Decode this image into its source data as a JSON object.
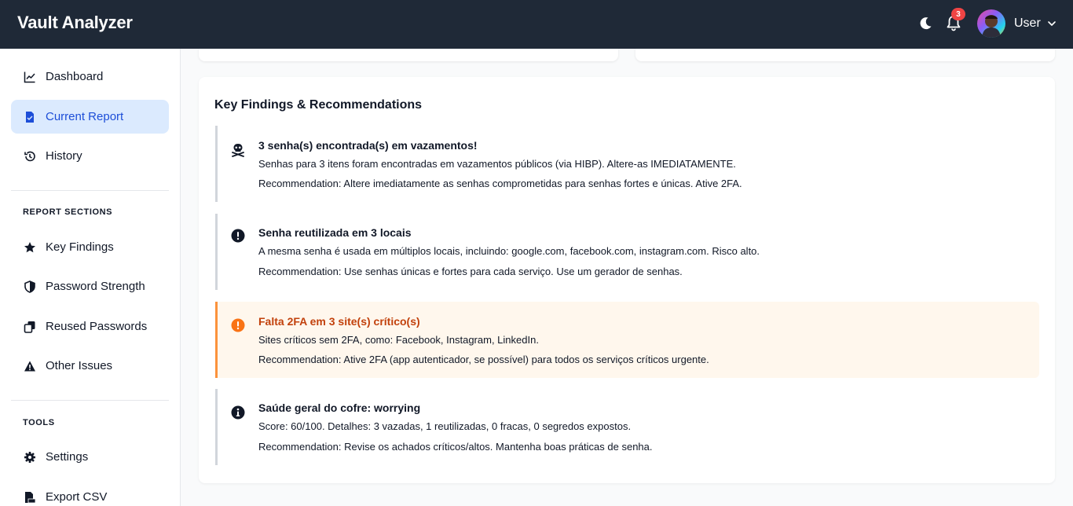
{
  "header": {
    "app_title": "Vault Analyzer",
    "notification_count": "3",
    "user_name": "User"
  },
  "sidebar": {
    "items": [
      {
        "label": "Dashboard",
        "icon": "chart-line-icon"
      },
      {
        "label": "Current Report",
        "icon": "file-report-icon",
        "active": true
      },
      {
        "label": "History",
        "icon": "history-icon"
      }
    ],
    "report_sections_title": "REPORT SECTIONS",
    "report_sections": [
      {
        "label": "Key Findings",
        "icon": "star-icon"
      },
      {
        "label": "Password Strength",
        "icon": "shield-icon"
      },
      {
        "label": "Reused Passwords",
        "icon": "copy-icon"
      },
      {
        "label": "Other Issues",
        "icon": "warning-icon"
      }
    ],
    "tools_title": "TOOLS",
    "tools": [
      {
        "label": "Settings",
        "icon": "gear-icon"
      },
      {
        "label": "Export CSV",
        "icon": "csv-file-icon"
      }
    ]
  },
  "findings_card": {
    "title": "Key Findings & Recommendations",
    "findings": [
      {
        "icon": "skull-crossbones-icon",
        "severity": "critical",
        "title": "3 senha(s) encontrada(s) em vazamentos!",
        "description": "Senhas para 3 itens foram encontradas em vazamentos públicos (via HIBP). Altere-as IMEDIATAMENTE.",
        "recommendation": "Recommendation: Altere imediatamente as senhas comprometidas para senhas fortes e únicas. Ative 2FA."
      },
      {
        "icon": "exclamation-circle-icon",
        "severity": "high",
        "title": "Senha reutilizada em 3 locais",
        "description": "A mesma senha é usada em múltiplos locais, incluindo: google.com, facebook.com, instagram.com. Risco alto.",
        "recommendation": "Recommendation: Use senhas únicas e fortes para cada serviço. Use um gerador de senhas."
      },
      {
        "icon": "exclamation-circle-icon",
        "severity": "medium",
        "title": "Falta 2FA em 3 site(s) crítico(s)",
        "description": "Sites críticos sem 2FA, como: Facebook, Instagram, LinkedIn.",
        "recommendation": "Recommendation: Ative 2FA (app autenticador, se possível) para todos os serviços críticos urgente."
      },
      {
        "icon": "info-circle-icon",
        "severity": "info",
        "title": "Saúde geral do cofre: worrying",
        "description": "Score: 60/100. Detalhes: 3 vazadas, 1 reutilizadas, 0 fracas, 0 segredos expostos.",
        "recommendation": "Recommendation: Revise os achados críticos/altos. Mantenha boas práticas de senha."
      }
    ]
  },
  "colors": {
    "header_bg": "#1f2937",
    "active_nav_bg": "#dbeafe",
    "active_nav_text": "#1d4ed8",
    "warn_bg": "#fff7ed",
    "warn_border": "#fb923c",
    "warn_text": "#c2410c",
    "badge": "#ef4444"
  }
}
